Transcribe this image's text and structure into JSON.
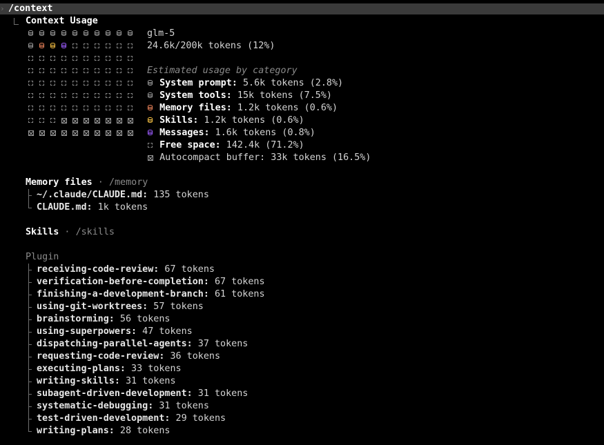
{
  "command": "/context",
  "header": {
    "title": "Context Usage",
    "model": "glm-5",
    "tokens_used": "24.6k/200k tokens (12%)"
  },
  "colors": {
    "system": "#9a9a9a",
    "memory": "#e8825a",
    "skills": "#f5c044",
    "messages": "#9d5cff",
    "free": "#8a8a8a",
    "buffer": "#9a9a9a"
  },
  "grid_rows": [
    [
      "system",
      "system",
      "system",
      "system",
      "system",
      "system",
      "system",
      "system",
      "system",
      "system"
    ],
    [
      "system",
      "memory",
      "skills",
      "messages",
      "free",
      "free",
      "free",
      "free",
      "free",
      "free"
    ],
    [
      "free",
      "free",
      "free",
      "free",
      "free",
      "free",
      "free",
      "free",
      "free",
      "free"
    ],
    [
      "free",
      "free",
      "free",
      "free",
      "free",
      "free",
      "free",
      "free",
      "free",
      "free"
    ],
    [
      "free",
      "free",
      "free",
      "free",
      "free",
      "free",
      "free",
      "free",
      "free",
      "free"
    ],
    [
      "free",
      "free",
      "free",
      "free",
      "free",
      "free",
      "free",
      "free",
      "free",
      "free"
    ],
    [
      "free",
      "free",
      "free",
      "free",
      "free",
      "free",
      "free",
      "free",
      "free",
      "free"
    ],
    [
      "free",
      "free",
      "free",
      "buffer",
      "buffer",
      "buffer",
      "buffer",
      "buffer",
      "buffer",
      "buffer"
    ],
    [
      "buffer",
      "buffer",
      "buffer",
      "buffer",
      "buffer",
      "buffer",
      "buffer",
      "buffer",
      "buffer",
      "buffer"
    ]
  ],
  "categories": {
    "heading": "Estimated usage by category",
    "items": [
      {
        "key": "system",
        "label": "System prompt:",
        "value": " 5.6k tokens (2.8%)",
        "label_bold": true
      },
      {
        "key": "system",
        "label": "System tools:",
        "value": " 15k tokens (7.5%)",
        "label_bold": true
      },
      {
        "key": "memory",
        "label": "Memory files:",
        "value": " 1.2k tokens (0.6%)",
        "label_bold": true
      },
      {
        "key": "skills",
        "label": "Skills:",
        "value": " 1.2k tokens (0.6%)",
        "label_bold": true
      },
      {
        "key": "messages",
        "label": "Messages:",
        "value": " 1.6k tokens (0.8%)",
        "label_bold": true
      },
      {
        "key": "free",
        "label": "Free space:",
        "value": " 142.4k (71.2%)",
        "label_bold": true
      },
      {
        "key": "buffer",
        "label": "Autocompact buffer:",
        "value": " 33k tokens (16.5%)",
        "label_bold": false
      }
    ]
  },
  "memory_section": {
    "title": "Memory files",
    "separator": " · ",
    "command": "/memory",
    "files": [
      {
        "name": "~/.claude/CLAUDE.md:",
        "tokens": " 135 tokens"
      },
      {
        "name": "CLAUDE.md:",
        "tokens": " 1k tokens"
      }
    ]
  },
  "skills_section": {
    "title": "Skills",
    "separator": " · ",
    "command": "/skills",
    "group": "Plugin",
    "skills": [
      {
        "name": "receiving-code-review:",
        "tokens": " 67 tokens"
      },
      {
        "name": "verification-before-completion:",
        "tokens": " 67 tokens"
      },
      {
        "name": "finishing-a-development-branch:",
        "tokens": " 61 tokens"
      },
      {
        "name": "using-git-worktrees:",
        "tokens": " 57 tokens"
      },
      {
        "name": "brainstorming:",
        "tokens": " 56 tokens"
      },
      {
        "name": "using-superpowers:",
        "tokens": " 47 tokens"
      },
      {
        "name": "dispatching-parallel-agents:",
        "tokens": " 37 tokens"
      },
      {
        "name": "requesting-code-review:",
        "tokens": " 36 tokens"
      },
      {
        "name": "executing-plans:",
        "tokens": " 33 tokens"
      },
      {
        "name": "writing-skills:",
        "tokens": " 31 tokens"
      },
      {
        "name": "subagent-driven-development:",
        "tokens": " 31 tokens"
      },
      {
        "name": "systematic-debugging:",
        "tokens": " 31 tokens"
      },
      {
        "name": "test-driven-development:",
        "tokens": " 29 tokens"
      },
      {
        "name": "writing-plans:",
        "tokens": " 28 tokens"
      }
    ]
  }
}
